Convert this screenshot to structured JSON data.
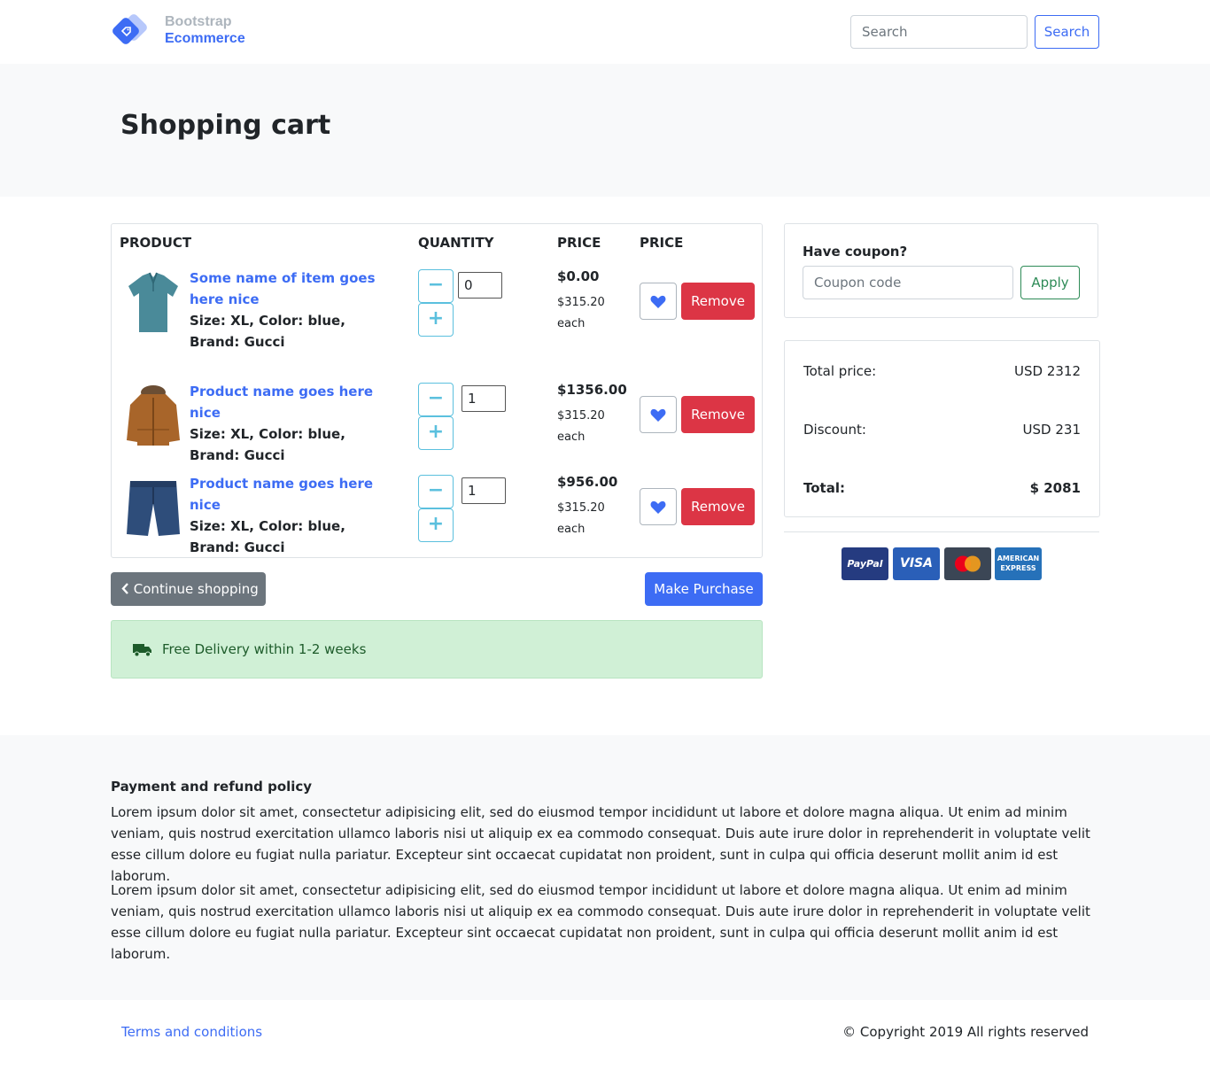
{
  "header": {
    "brand_line1": "Bootstrap",
    "brand_line2": "Ecommerce",
    "search_placeholder": "Search",
    "search_button": "Search"
  },
  "banner": {
    "title": "Shopping cart"
  },
  "cart": {
    "headers": {
      "product": "PRODUCT",
      "quantity": "QUANTITY",
      "price": "PRICE",
      "price2": "PRICE"
    },
    "items": [
      {
        "name": "Some name of item goes here nice",
        "meta1": "Size: XL, Color: blue,",
        "meta2": "Brand: Gucci",
        "quantity": "0",
        "price": "$0.00",
        "each_price": "$315.20",
        "each_label": "each",
        "image_icon": "tshirt-icon"
      },
      {
        "name": "Product name goes here nice",
        "meta1": "Size: XL, Color: blue,",
        "meta2": "Brand: Gucci",
        "quantity": "1",
        "price": "$1356.00",
        "each_price": "$315.20",
        "each_label": "each",
        "image_icon": "jacket-icon"
      },
      {
        "name": "Product name goes here nice",
        "meta1": "Size: XL, Color: blue,",
        "meta2": "Brand: Gucci",
        "quantity": "1",
        "price": "$956.00",
        "each_price": "$315.20",
        "each_label": "each",
        "image_icon": "shorts-icon"
      }
    ],
    "remove_label": "Remove",
    "minus_glyph": "−",
    "plus_glyph": "+"
  },
  "actions": {
    "continue_label": "Continue shopping",
    "purchase_label": "Make Purchase"
  },
  "delivery": {
    "text": "Free Delivery within 1-2 weeks"
  },
  "coupon": {
    "label": "Have coupon?",
    "placeholder": "Coupon code",
    "apply_label": "Apply"
  },
  "totals": {
    "total_price_label": "Total price:",
    "total_price_value": "USD 2312",
    "discount_label": "Discount:",
    "discount_value": "USD 231",
    "total_label": "Total:",
    "total_value": "$ 2081"
  },
  "payments": {
    "paypal": "PayPal",
    "visa": "VISA",
    "amex_line1": "AMERICAN",
    "amex_line2": "EXPRESS"
  },
  "policy": {
    "title": "Payment and refund policy",
    "p1": "Lorem ipsum dolor sit amet, consectetur adipisicing elit, sed do eiusmod tempor incididunt ut labore et dolore magna aliqua. Ut enim ad minim veniam, quis nostrud exercitation ullamco laboris nisi ut aliquip ex ea commodo consequat. Duis aute irure dolor in reprehenderit in voluptate velit esse cillum dolore eu fugiat nulla pariatur. Excepteur sint occaecat cupidatat non proident, sunt in culpa qui officia deserunt mollit anim id est laborum.",
    "p2": "Lorem ipsum dolor sit amet, consectetur adipisicing elit, sed do eiusmod tempor incididunt ut labore et dolore magna aliqua. Ut enim ad minim veniam, quis nostrud exercitation ullamco laboris nisi ut aliquip ex ea commodo consequat. Duis aute irure dolor in reprehenderit in voluptate velit esse cillum dolore eu fugiat nulla pariatur. Excepteur sint occaecat cupidatat non proident, sunt in culpa qui officia deserunt mollit anim id est laborum."
  },
  "footer": {
    "terms": "Terms and conditions",
    "copyright": "© Copyright 2019 All rights reserved"
  },
  "colors": {
    "primary": "#3d6cf4",
    "danger": "#dc3545",
    "secondary": "#6c757d",
    "success_bg": "#d0f0d6"
  }
}
